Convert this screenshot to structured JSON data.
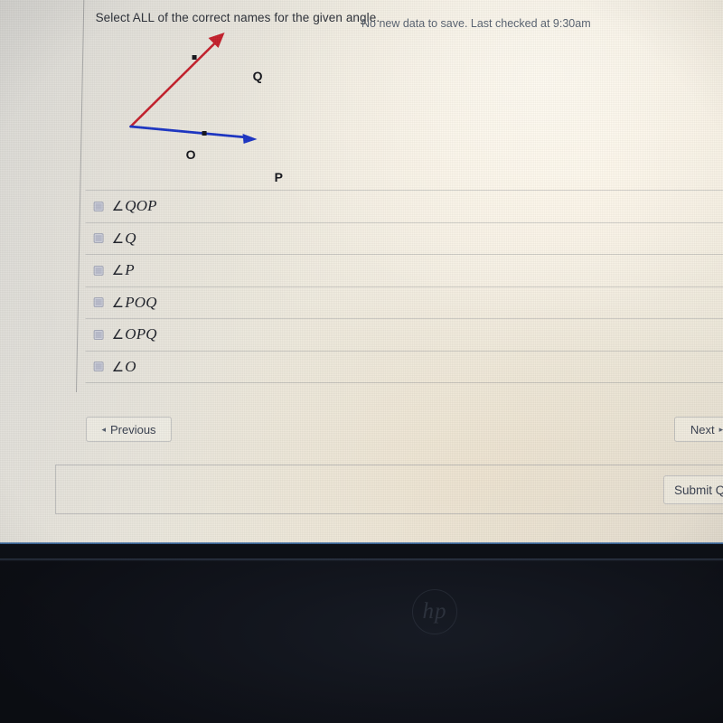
{
  "question": {
    "prompt": "Select ALL of the correct names for the given angle."
  },
  "figure": {
    "vertex_label": "O",
    "ray1_point_label": "Q",
    "ray2_point_label": "P",
    "ray1_color": "#c4202c",
    "ray2_color": "#1c35c4",
    "label_color": "#15161c"
  },
  "options": [
    {
      "angle_symbol": "∠",
      "name": "QOP",
      "checked": false
    },
    {
      "angle_symbol": "∠",
      "name": "Q",
      "checked": false
    },
    {
      "angle_symbol": "∠",
      "name": "P",
      "checked": false
    },
    {
      "angle_symbol": "∠",
      "name": "POQ",
      "checked": false
    },
    {
      "angle_symbol": "∠",
      "name": "OPQ",
      "checked": false
    },
    {
      "angle_symbol": "∠",
      "name": "O",
      "checked": false
    }
  ],
  "nav": {
    "previous_label": "Previous",
    "previous_caret": "◂",
    "next_label": "Next",
    "next_caret": "▸"
  },
  "save_bar": {
    "status_text": "No new data to save. Last checked at 9:30am",
    "submit_label": "Submit Q"
  },
  "device": {
    "brand_logo": "hp"
  }
}
